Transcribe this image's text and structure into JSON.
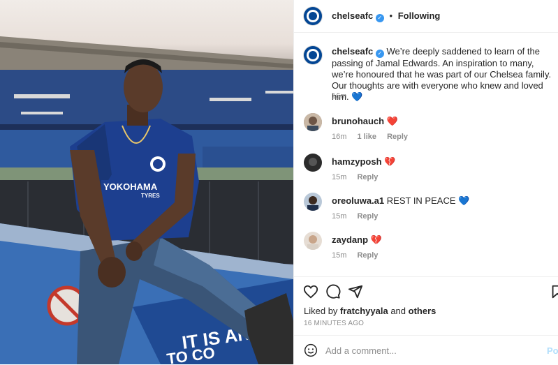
{
  "header": {
    "username": "chelseafc",
    "separator": "•",
    "follow_status": "Following"
  },
  "caption": {
    "username": "chelseafc",
    "text": "We’re deeply saddened to learn of the passing of Jamal Edwards. An inspiration to many, we’re honoured that he was part of our Chelsea family. Our thoughts are with everyone who knew and loved him. 💙",
    "time": "16m"
  },
  "comments": [
    {
      "username": "brunohauch",
      "text": "❤️",
      "time": "16m",
      "likes": "1 like",
      "reply": "Reply"
    },
    {
      "username": "hamzyposh",
      "text": "💔",
      "time": "15m",
      "reply": "Reply"
    },
    {
      "username": "oreoluwa.a1",
      "text": "REST IN PEACE 💙",
      "time": "15m",
      "reply": "Reply"
    },
    {
      "username": "zaydanp",
      "text": "💔",
      "time": "15m",
      "reply": "Reply"
    }
  ],
  "likes": {
    "prefix": "Liked by",
    "user": "fratchyyala",
    "and": "and",
    "others": "others"
  },
  "posted_ago": "16 MINUTES AGO",
  "add_comment": {
    "placeholder": "Add a comment...",
    "post_label": "Post"
  },
  "photo": {
    "shirt_sponsor": "YOKOHAMA",
    "shirt_sponsor_sub": "TYRES",
    "banner_text": "IT IS AN",
    "banner_text_2": "TO CO"
  },
  "colors": {
    "brand_blue": "#034694",
    "link_blue": "#3897f0",
    "muted": "#8e8e8e",
    "post_disabled": "#b2dffc"
  },
  "icons": [
    "heart-icon",
    "comment-icon",
    "share-icon",
    "bookmark-icon",
    "emoji-icon",
    "verified-icon"
  ]
}
